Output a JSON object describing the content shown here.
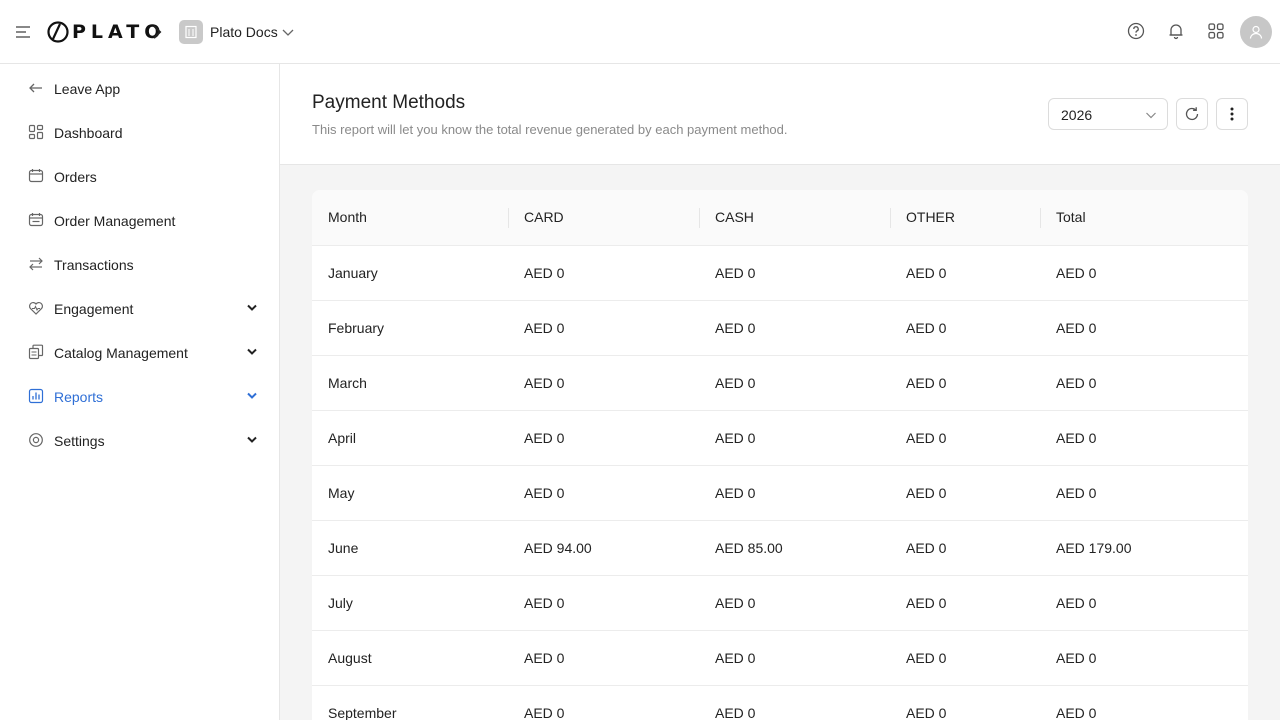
{
  "topbar": {
    "logo_text": "PLATO",
    "workspace_name": "Plato Docs",
    "icons": [
      "menu-icon",
      "chevron-right-icon",
      "building-icon",
      "chevron-down-icon",
      "help-icon",
      "bell-icon",
      "apps-grid-icon",
      "user-icon"
    ]
  },
  "sidebar": {
    "items": [
      {
        "label": "Leave App",
        "icon": "arrow-left-icon"
      },
      {
        "label": "Dashboard",
        "icon": "dashboard-icon"
      },
      {
        "label": "Orders",
        "icon": "orders-icon"
      },
      {
        "label": "Order Management",
        "icon": "order-management-icon"
      },
      {
        "label": "Transactions",
        "icon": "transactions-icon"
      },
      {
        "label": "Engagement",
        "icon": "heart-icon",
        "expandable": true
      },
      {
        "label": "Catalog Management",
        "icon": "catalog-icon",
        "expandable": true
      },
      {
        "label": "Reports",
        "icon": "reports-icon",
        "expandable": true,
        "active": true
      },
      {
        "label": "Settings",
        "icon": "settings-icon",
        "expandable": true
      }
    ],
    "active_color": "#2f6fd6"
  },
  "page": {
    "title": "Payment Methods",
    "subtitle": "This report will let you know the total revenue generated by each payment method.",
    "year": "2026"
  },
  "table": {
    "columns": [
      "Month",
      "CARD",
      "CASH",
      "OTHER",
      "Total"
    ],
    "rows": [
      [
        "January",
        "AED 0",
        "AED 0",
        "AED 0",
        "AED 0"
      ],
      [
        "February",
        "AED 0",
        "AED 0",
        "AED 0",
        "AED 0"
      ],
      [
        "March",
        "AED 0",
        "AED 0",
        "AED 0",
        "AED 0"
      ],
      [
        "April",
        "AED 0",
        "AED 0",
        "AED 0",
        "AED 0"
      ],
      [
        "May",
        "AED 0",
        "AED 0",
        "AED 0",
        "AED 0"
      ],
      [
        "June",
        "AED 94.00",
        "AED 85.00",
        "AED 0",
        "AED 179.00"
      ],
      [
        "July",
        "AED 0",
        "AED 0",
        "AED 0",
        "AED 0"
      ],
      [
        "August",
        "AED 0",
        "AED 0",
        "AED 0",
        "AED 0"
      ],
      [
        "September",
        "AED 0",
        "AED 0",
        "AED 0",
        "AED 0"
      ]
    ]
  }
}
